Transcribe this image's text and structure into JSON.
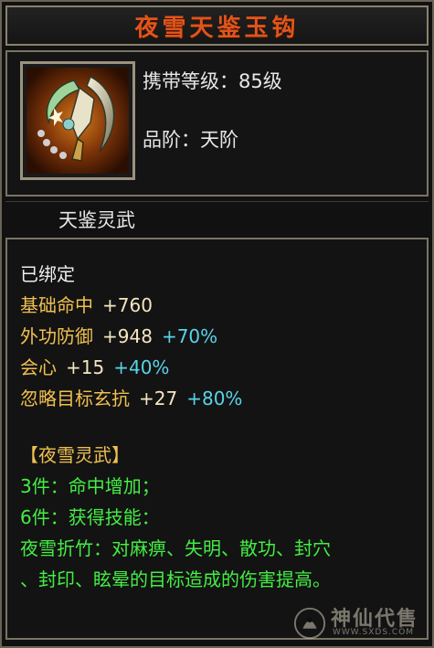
{
  "item": {
    "title": "夜雪天鉴玉钩",
    "level_line": "携带等级：85级",
    "grade_line": "品阶：天阶",
    "type_line": "天鉴灵武",
    "icon": "jade-hook-weapon-icon"
  },
  "stats": {
    "bound": "已绑定",
    "lines": [
      {
        "label": "基础命中",
        "value": "+760",
        "bonus": ""
      },
      {
        "label": "外功防御",
        "value": "+948",
        "bonus": "+70%"
      },
      {
        "label": "会心",
        "value": "+15",
        "bonus": "+40%"
      },
      {
        "label": "忽略目标玄抗",
        "value": "+27",
        "bonus": "+80%"
      }
    ]
  },
  "set": {
    "name": "【夜雪灵武】",
    "line1": "3件：命中增加；",
    "line2": "6件：获得技能：",
    "line3": "夜雪折竹：对麻痹、失明、散功、封穴",
    "line4": "、封印、眩晕的目标造成的伤害提高。"
  },
  "watermark": {
    "brand": "神仙代售",
    "url": "WWW.SXDS.COM"
  },
  "colors": {
    "title": "#e0551c",
    "label": "#f0c050",
    "value": "#f4e6c0",
    "bonus": "#58d4e8",
    "set": "#44ee44"
  }
}
